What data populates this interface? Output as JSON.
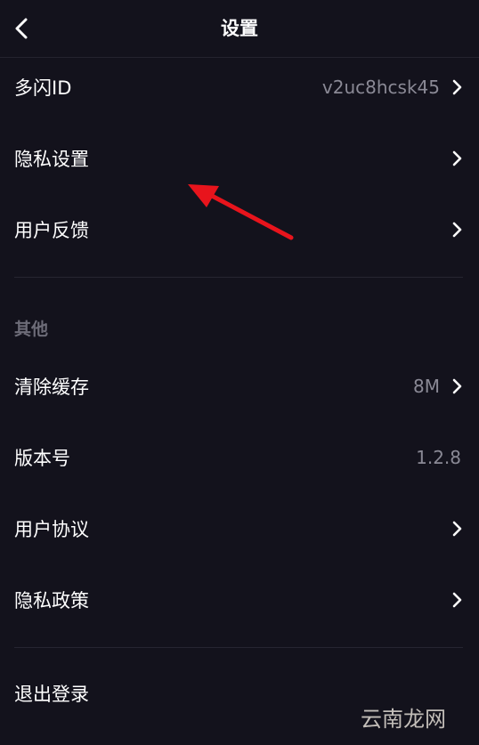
{
  "header": {
    "title": "设置"
  },
  "rows": {
    "duoshan_id": {
      "label": "多闪ID",
      "value": "v2uc8hcsk45"
    },
    "privacy_settings": {
      "label": "隐私设置"
    },
    "feedback": {
      "label": "用户反馈"
    },
    "clear_cache": {
      "label": "清除缓存",
      "value": "8M"
    },
    "version": {
      "label": "版本号",
      "value": "1.2.8"
    },
    "user_agreement": {
      "label": "用户协议"
    },
    "privacy_policy": {
      "label": "隐私政策"
    },
    "logout": {
      "label": "退出登录"
    }
  },
  "sections": {
    "other": "其他"
  },
  "watermark": "云南龙网",
  "colors": {
    "background": "#13121c",
    "text": "#ffffff",
    "secondary_text": "#8a8995",
    "section_text": "#6d6c78",
    "annotation_arrow": "#e8141c"
  }
}
